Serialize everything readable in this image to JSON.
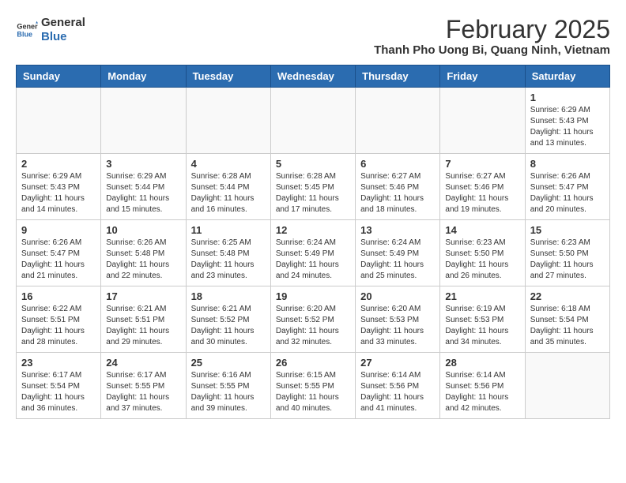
{
  "header": {
    "logo_line1": "General",
    "logo_line2": "Blue",
    "month_title": "February 2025",
    "location": "Thanh Pho Uong Bi, Quang Ninh, Vietnam"
  },
  "weekdays": [
    "Sunday",
    "Monday",
    "Tuesday",
    "Wednesday",
    "Thursday",
    "Friday",
    "Saturday"
  ],
  "weeks": [
    [
      {
        "day": "",
        "info": ""
      },
      {
        "day": "",
        "info": ""
      },
      {
        "day": "",
        "info": ""
      },
      {
        "day": "",
        "info": ""
      },
      {
        "day": "",
        "info": ""
      },
      {
        "day": "",
        "info": ""
      },
      {
        "day": "1",
        "info": "Sunrise: 6:29 AM\nSunset: 5:43 PM\nDaylight: 11 hours\nand 13 minutes."
      }
    ],
    [
      {
        "day": "2",
        "info": "Sunrise: 6:29 AM\nSunset: 5:43 PM\nDaylight: 11 hours\nand 14 minutes."
      },
      {
        "day": "3",
        "info": "Sunrise: 6:29 AM\nSunset: 5:44 PM\nDaylight: 11 hours\nand 15 minutes."
      },
      {
        "day": "4",
        "info": "Sunrise: 6:28 AM\nSunset: 5:44 PM\nDaylight: 11 hours\nand 16 minutes."
      },
      {
        "day": "5",
        "info": "Sunrise: 6:28 AM\nSunset: 5:45 PM\nDaylight: 11 hours\nand 17 minutes."
      },
      {
        "day": "6",
        "info": "Sunrise: 6:27 AM\nSunset: 5:46 PM\nDaylight: 11 hours\nand 18 minutes."
      },
      {
        "day": "7",
        "info": "Sunrise: 6:27 AM\nSunset: 5:46 PM\nDaylight: 11 hours\nand 19 minutes."
      },
      {
        "day": "8",
        "info": "Sunrise: 6:26 AM\nSunset: 5:47 PM\nDaylight: 11 hours\nand 20 minutes."
      }
    ],
    [
      {
        "day": "9",
        "info": "Sunrise: 6:26 AM\nSunset: 5:47 PM\nDaylight: 11 hours\nand 21 minutes."
      },
      {
        "day": "10",
        "info": "Sunrise: 6:26 AM\nSunset: 5:48 PM\nDaylight: 11 hours\nand 22 minutes."
      },
      {
        "day": "11",
        "info": "Sunrise: 6:25 AM\nSunset: 5:48 PM\nDaylight: 11 hours\nand 23 minutes."
      },
      {
        "day": "12",
        "info": "Sunrise: 6:24 AM\nSunset: 5:49 PM\nDaylight: 11 hours\nand 24 minutes."
      },
      {
        "day": "13",
        "info": "Sunrise: 6:24 AM\nSunset: 5:49 PM\nDaylight: 11 hours\nand 25 minutes."
      },
      {
        "day": "14",
        "info": "Sunrise: 6:23 AM\nSunset: 5:50 PM\nDaylight: 11 hours\nand 26 minutes."
      },
      {
        "day": "15",
        "info": "Sunrise: 6:23 AM\nSunset: 5:50 PM\nDaylight: 11 hours\nand 27 minutes."
      }
    ],
    [
      {
        "day": "16",
        "info": "Sunrise: 6:22 AM\nSunset: 5:51 PM\nDaylight: 11 hours\nand 28 minutes."
      },
      {
        "day": "17",
        "info": "Sunrise: 6:21 AM\nSunset: 5:51 PM\nDaylight: 11 hours\nand 29 minutes."
      },
      {
        "day": "18",
        "info": "Sunrise: 6:21 AM\nSunset: 5:52 PM\nDaylight: 11 hours\nand 30 minutes."
      },
      {
        "day": "19",
        "info": "Sunrise: 6:20 AM\nSunset: 5:52 PM\nDaylight: 11 hours\nand 32 minutes."
      },
      {
        "day": "20",
        "info": "Sunrise: 6:20 AM\nSunset: 5:53 PM\nDaylight: 11 hours\nand 33 minutes."
      },
      {
        "day": "21",
        "info": "Sunrise: 6:19 AM\nSunset: 5:53 PM\nDaylight: 11 hours\nand 34 minutes."
      },
      {
        "day": "22",
        "info": "Sunrise: 6:18 AM\nSunset: 5:54 PM\nDaylight: 11 hours\nand 35 minutes."
      }
    ],
    [
      {
        "day": "23",
        "info": "Sunrise: 6:17 AM\nSunset: 5:54 PM\nDaylight: 11 hours\nand 36 minutes."
      },
      {
        "day": "24",
        "info": "Sunrise: 6:17 AM\nSunset: 5:55 PM\nDaylight: 11 hours\nand 37 minutes."
      },
      {
        "day": "25",
        "info": "Sunrise: 6:16 AM\nSunset: 5:55 PM\nDaylight: 11 hours\nand 39 minutes."
      },
      {
        "day": "26",
        "info": "Sunrise: 6:15 AM\nSunset: 5:55 PM\nDaylight: 11 hours\nand 40 minutes."
      },
      {
        "day": "27",
        "info": "Sunrise: 6:14 AM\nSunset: 5:56 PM\nDaylight: 11 hours\nand 41 minutes."
      },
      {
        "day": "28",
        "info": "Sunrise: 6:14 AM\nSunset: 5:56 PM\nDaylight: 11 hours\nand 42 minutes."
      },
      {
        "day": "",
        "info": ""
      }
    ]
  ]
}
